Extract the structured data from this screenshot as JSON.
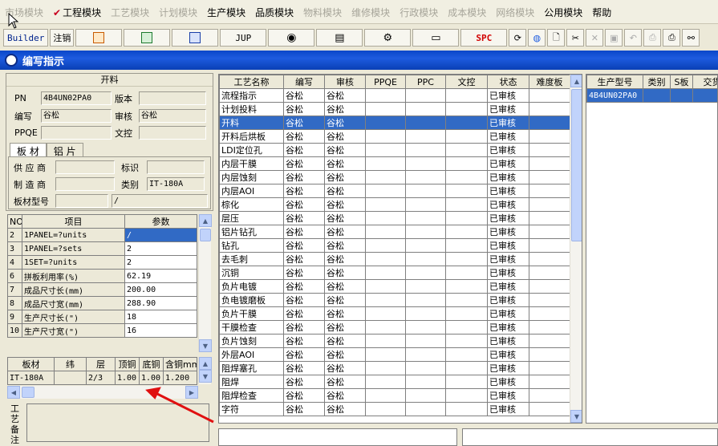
{
  "menu": [
    {
      "label": "市场模块",
      "disabled": true
    },
    {
      "label": "工程模块",
      "disabled": false,
      "checked": true
    },
    {
      "label": "工艺模块",
      "disabled": true
    },
    {
      "label": "计划模块",
      "disabled": true
    },
    {
      "label": "生产模块",
      "disabled": false
    },
    {
      "label": "品质模块",
      "disabled": false
    },
    {
      "label": "物料模块",
      "disabled": true
    },
    {
      "label": "维修模块",
      "disabled": true
    },
    {
      "label": "行政模块",
      "disabled": true
    },
    {
      "label": "成本模块",
      "disabled": true
    },
    {
      "label": "网络模块",
      "disabled": true
    },
    {
      "label": "公用模块",
      "disabled": false
    },
    {
      "label": "帮助",
      "disabled": false
    }
  ],
  "toolbar": {
    "builder": "Builder",
    "logout": "注销",
    "jup": "JUP",
    "spc": "SPC"
  },
  "window": {
    "title": "编写指示"
  },
  "left": {
    "header": "开料",
    "pn_label": "PN",
    "pn_value": "4B4UN02PA0",
    "version_label": "版本",
    "version_value": "",
    "writer_label": "编写",
    "writer_value": "谷松",
    "review_label": "审核",
    "review_value": "谷松",
    "ppqe_label": "PPQE",
    "ppqe_value": "",
    "wenkong_label": "文控",
    "wenkong_value": "",
    "tabs": [
      "板 材",
      "铝 片"
    ],
    "supplier_label": "供 应 商",
    "supplier_value": "",
    "mark_label": "标识",
    "mark_value": "",
    "maker_label": "制 造 商",
    "maker_value": "",
    "category_label": "类别",
    "category_value": "IT-180A",
    "model_label": "板材型号",
    "model_value": "",
    "model_value2": "/",
    "params": {
      "headers": [
        "NO",
        "项目",
        "参数"
      ],
      "rows": [
        [
          "2",
          "1PANEL=?units",
          "/"
        ],
        [
          "3",
          "1PANEL=?sets",
          "2"
        ],
        [
          "4",
          "1SET=?units",
          "2"
        ],
        [
          "6",
          "拼板利用率(%)",
          "62.19"
        ],
        [
          "7",
          "成品尺寸长(mm)",
          "200.00"
        ],
        [
          "8",
          "成品尺寸宽(mm)",
          "288.90"
        ],
        [
          "9",
          "生产尺寸长(\")",
          "18"
        ],
        [
          "10",
          "生产尺寸宽(\")",
          "16"
        ]
      ]
    },
    "material": {
      "headers": [
        "板材",
        "纬",
        "层",
        "顶铜",
        "底铜",
        "含铜mm"
      ],
      "rows": [
        [
          "IT-180A",
          "",
          "2/3",
          "1.00",
          "1.00",
          "1.200"
        ]
      ]
    },
    "remark_label": "工艺备注"
  },
  "process": {
    "headers": [
      "工艺名称",
      "编写",
      "审核",
      "PPQE",
      "PPC",
      "文控",
      "状态",
      "难度板"
    ],
    "selected_index": 2,
    "rows": [
      [
        "流程指示",
        "谷松",
        "谷松",
        "",
        "",
        "",
        "已审核",
        ""
      ],
      [
        "计划投料",
        "谷松",
        "谷松",
        "",
        "",
        "",
        "已审核",
        ""
      ],
      [
        "开料",
        "谷松",
        "谷松",
        "",
        "",
        "",
        "已审核",
        ""
      ],
      [
        "开料后烘板",
        "谷松",
        "谷松",
        "",
        "",
        "",
        "已审核",
        ""
      ],
      [
        "LDI定位孔",
        "谷松",
        "谷松",
        "",
        "",
        "",
        "已审核",
        ""
      ],
      [
        "内层干膜",
        "谷松",
        "谷松",
        "",
        "",
        "",
        "已审核",
        ""
      ],
      [
        "内层蚀刻",
        "谷松",
        "谷松",
        "",
        "",
        "",
        "已审核",
        ""
      ],
      [
        "内层AOI",
        "谷松",
        "谷松",
        "",
        "",
        "",
        "已审核",
        ""
      ],
      [
        "棕化",
        "谷松",
        "谷松",
        "",
        "",
        "",
        "已审核",
        ""
      ],
      [
        "层压",
        "谷松",
        "谷松",
        "",
        "",
        "",
        "已审核",
        ""
      ],
      [
        "铝片钻孔",
        "谷松",
        "谷松",
        "",
        "",
        "",
        "已审核",
        ""
      ],
      [
        "钻孔",
        "谷松",
        "谷松",
        "",
        "",
        "",
        "已审核",
        ""
      ],
      [
        "去毛刺",
        "谷松",
        "谷松",
        "",
        "",
        "",
        "已审核",
        ""
      ],
      [
        "沉铜",
        "谷松",
        "谷松",
        "",
        "",
        "",
        "已审核",
        ""
      ],
      [
        "负片电镀",
        "谷松",
        "谷松",
        "",
        "",
        "",
        "已审核",
        ""
      ],
      [
        "负电镀磨板",
        "谷松",
        "谷松",
        "",
        "",
        "",
        "已审核",
        ""
      ],
      [
        "负片干膜",
        "谷松",
        "谷松",
        "",
        "",
        "",
        "已审核",
        ""
      ],
      [
        "干膜检查",
        "谷松",
        "谷松",
        "",
        "",
        "",
        "已审核",
        ""
      ],
      [
        "负片蚀刻",
        "谷松",
        "谷松",
        "",
        "",
        "",
        "已审核",
        ""
      ],
      [
        "外层AOI",
        "谷松",
        "谷松",
        "",
        "",
        "",
        "已审核",
        ""
      ],
      [
        "阻焊塞孔",
        "谷松",
        "谷松",
        "",
        "",
        "",
        "已审核",
        ""
      ],
      [
        "阻焊",
        "谷松",
        "谷松",
        "",
        "",
        "",
        "已审核",
        ""
      ],
      [
        "阻焊检查",
        "谷松",
        "谷松",
        "",
        "",
        "",
        "已审核",
        ""
      ],
      [
        "字符",
        "谷松",
        "谷松",
        "",
        "",
        "",
        "已审核",
        ""
      ]
    ]
  },
  "product": {
    "headers": [
      "生产型号",
      "类别",
      "S板",
      "交货"
    ],
    "rows": [
      [
        "4B4UN02PA0",
        "",
        "",
        ""
      ]
    ]
  },
  "colors": {
    "title_blue": "#0a46c9",
    "selection": "#316ac5",
    "arrow": "#e01010"
  }
}
